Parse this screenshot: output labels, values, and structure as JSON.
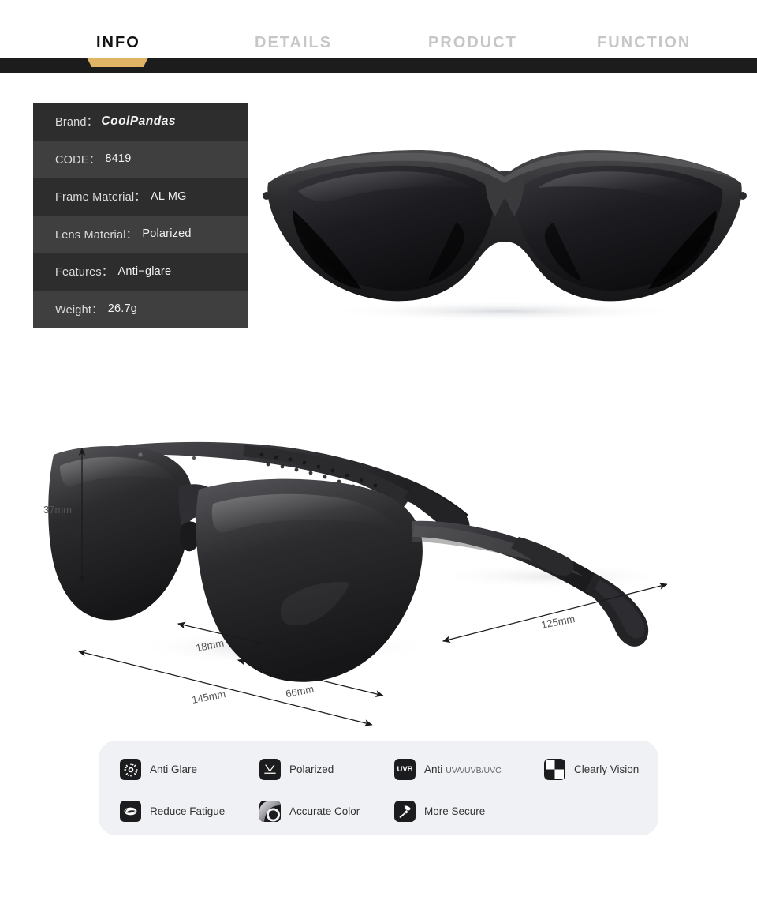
{
  "tabs": [
    {
      "label": "INFO",
      "active": true
    },
    {
      "label": "DETAILS",
      "active": false
    },
    {
      "label": "PRODUCT",
      "active": false
    },
    {
      "label": "FUNCTION",
      "active": false
    }
  ],
  "colors": {
    "tab_active_text": "#111111",
    "tab_inactive_text": "#c6c6c6",
    "tab_indicator": "#dfb565",
    "dark_bar": "#1c1c1c",
    "spec_row_odd": "#2d2d2d",
    "spec_row_even": "#3f3f3f",
    "feature_panel_bg": "#f0f1f4",
    "badge_bg": "#1c1c1e"
  },
  "spec_table": {
    "rows": [
      {
        "label": "Brand：",
        "value": "CoolPandas",
        "brand": true
      },
      {
        "label": "CODE：",
        "value": "8419"
      },
      {
        "label": "Frame Material：",
        "value": "AL MG"
      },
      {
        "label": "Lens Material：",
        "value": "Polarized"
      },
      {
        "label": "Features：",
        "value": "Anti−glare"
      },
      {
        "label": "Weight：",
        "value": "26.7g"
      }
    ]
  },
  "dimensions": {
    "height": "37mm",
    "bridge": "18mm",
    "total_width": "145mm",
    "lens_span": "66mm",
    "temple_length": "125mm"
  },
  "features": [
    {
      "label": "Anti Glare",
      "sub": "",
      "icon": "sun-icon"
    },
    {
      "label": "Polarized",
      "sub": "",
      "icon": "polarized-arrows-icon"
    },
    {
      "label": "Anti",
      "sub": "UVA/UVB/UVC",
      "icon": "uvb-icon",
      "badge_text": "UVB"
    },
    {
      "label": "Clearly Vision",
      "sub": "",
      "icon": "checkerboard-icon"
    },
    {
      "label": "Reduce Fatigue",
      "sub": "",
      "icon": "eye-icon"
    },
    {
      "label": "Accurate Color",
      "sub": "",
      "icon": "color-gradient-icon"
    },
    {
      "label": "More Secure",
      "sub": "",
      "icon": "hammer-icon"
    }
  ]
}
